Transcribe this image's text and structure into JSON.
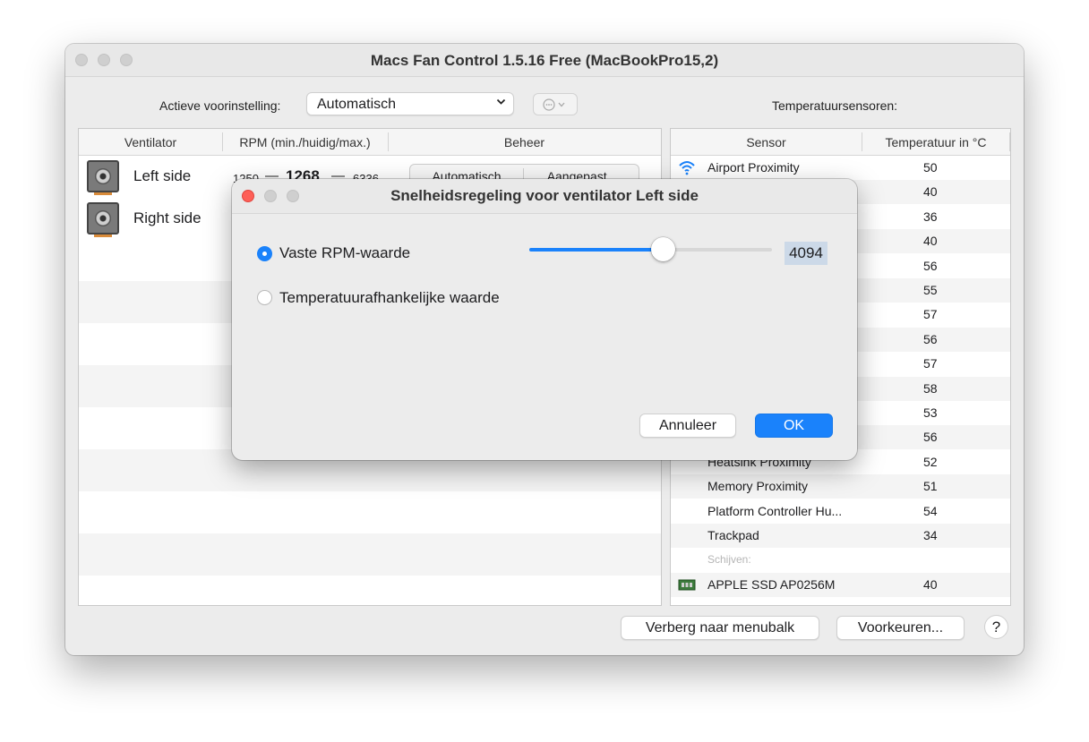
{
  "window": {
    "title": "Macs Fan Control 1.5.16 Free (MacBookPro15,2)"
  },
  "toolbar": {
    "preset_label": "Actieve voorinstelling:",
    "preset_value": "Automatisch",
    "more_icon": "ellipsis-circle-icon",
    "sensors_label": "Temperatuursensoren:"
  },
  "fans": {
    "columns": [
      "Ventilator",
      "RPM (min./huidig/max.)",
      "Beheer"
    ],
    "rows": [
      {
        "name": "Left side",
        "min": "1250",
        "current": "1268",
        "max": "6336",
        "auto": "Automatisch",
        "custom": "Aangepast..."
      },
      {
        "name": "Right side"
      }
    ]
  },
  "sensors": {
    "columns": [
      "Sensor",
      "Temperatuur in °C"
    ],
    "rows": [
      {
        "name": "Airport Proximity",
        "value": "50",
        "icon": "wifi-icon"
      },
      {
        "name": "",
        "value": "40"
      },
      {
        "name": "",
        "value": "36"
      },
      {
        "name": "",
        "value": "40"
      },
      {
        "name": "",
        "value": "56"
      },
      {
        "name": "",
        "value": "55"
      },
      {
        "name": "",
        "value": "57"
      },
      {
        "name": "",
        "value": "56"
      },
      {
        "name": "",
        "value": "57"
      },
      {
        "name": "",
        "value": "58"
      },
      {
        "name": "",
        "value": "53"
      },
      {
        "name": "",
        "value": "56"
      },
      {
        "name": "Heatsink Proximity",
        "value": "52"
      },
      {
        "name": "Memory Proximity",
        "value": "51"
      },
      {
        "name": "Platform Controller Hu...",
        "value": "54"
      },
      {
        "name": "Trackpad",
        "value": "34"
      }
    ],
    "group_label": "Schijven:",
    "disk": {
      "name": "APPLE SSD AP0256M",
      "value": "40",
      "icon": "ssd-icon"
    }
  },
  "footer": {
    "hide_label": "Verberg naar menubalk",
    "prefs_label": "Voorkeuren...",
    "help_label": "?"
  },
  "dialog": {
    "title": "Snelheidsregeling voor ventilator Left side",
    "option_fixed": "Vaste RPM-waarde",
    "option_temp": "Temperatuurafhankelijke waarde",
    "rpm_value": "4094",
    "slider_fraction": 0.55,
    "cancel_label": "Annuleer",
    "ok_label": "OK"
  },
  "colors": {
    "accent": "#1a82fb",
    "close": "#fe5f57"
  }
}
